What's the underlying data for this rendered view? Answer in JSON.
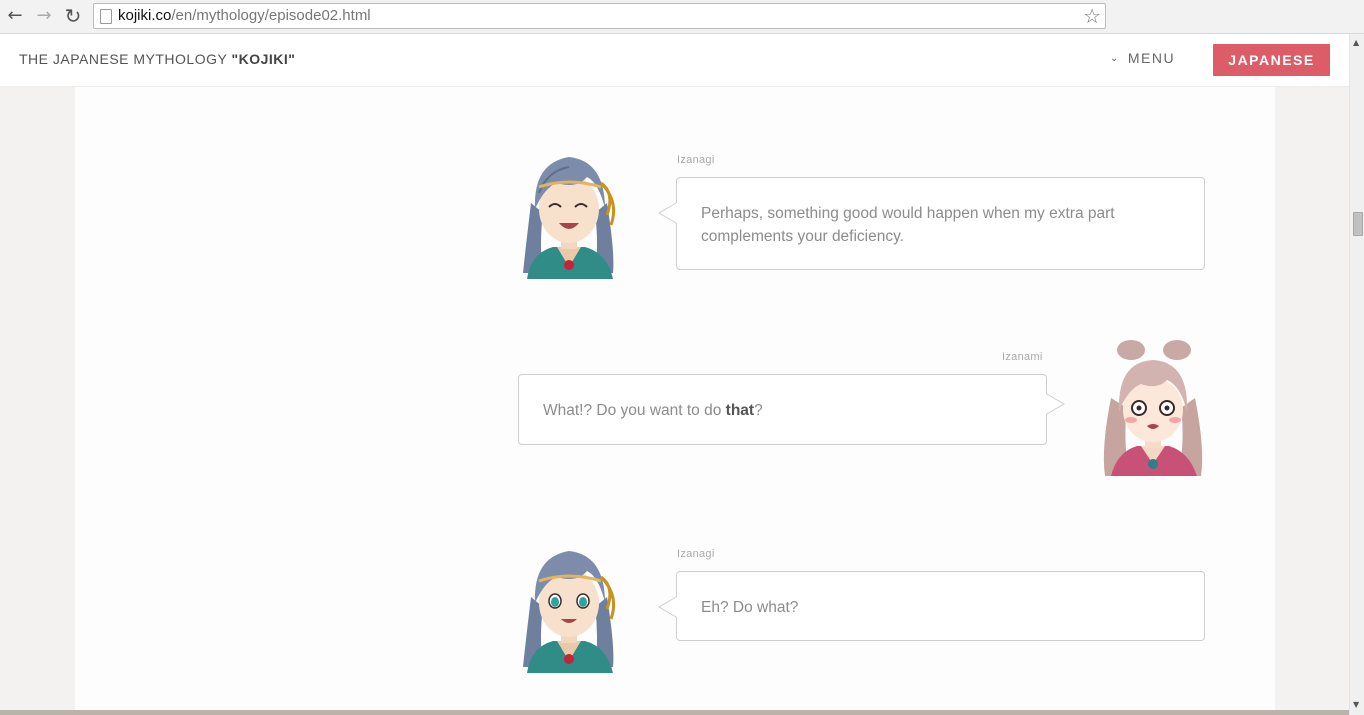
{
  "browser": {
    "url_host": "kojiki.co",
    "url_path": "/en/mythology/episode02.html",
    "back_icon": "arrow-left-icon",
    "forward_icon": "arrow-right-icon",
    "reload_icon": "reload-icon",
    "bookmark_icon": "star-icon"
  },
  "header": {
    "title_prefix": "THE JAPANESE MYTHOLOGY ",
    "title_bold": "\"KOJIKI\"",
    "menu_label": "MENU",
    "language_button": "JAPANESE",
    "accent_color": "#dc5c67"
  },
  "dialogue": [
    {
      "speaker": "Izanagi",
      "side": "left",
      "avatar": "izanagi-smiling",
      "text": "Perhaps, something good would happen when my extra part complements your deficiency."
    },
    {
      "speaker": "Izanami",
      "side": "right",
      "avatar": "izanami-surprised",
      "text_before": "What!? Do you want to do ",
      "text_bold": "that",
      "text_after": "?"
    },
    {
      "speaker": "Izanagi",
      "side": "left",
      "avatar": "izanagi-neutral",
      "text": "Eh? Do what?"
    }
  ]
}
